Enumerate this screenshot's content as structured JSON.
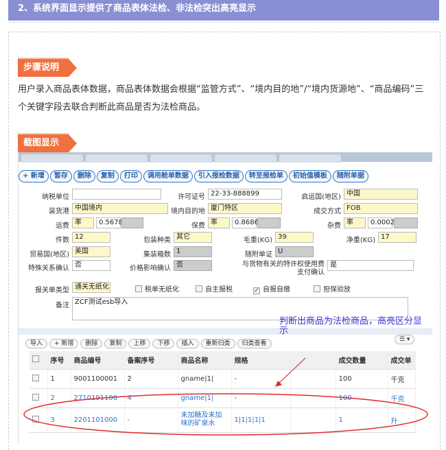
{
  "header": {
    "title": "2、系统界面显示提供了商品表体法检、非法检突出高亮显示"
  },
  "step": {
    "tag": "步骤说明",
    "text": "用户录入商品表体数据，商品表体数据会根据“监管方式”、“境内目的地”/“境内货源地”、“商品编码”三个关键字段去联合判断此商品是否为法检商品。"
  },
  "screenshot": {
    "tag": "截图显示"
  },
  "toolbar": [
    "+ 新增",
    "暂存",
    "删除",
    "复制",
    "打印",
    "调用舱单数据",
    "引入报检数据",
    "转至报检单",
    "初始值模板",
    "随附单据"
  ],
  "form": {
    "consignee_label": "纳税单位",
    "consignee_value": "",
    "license_label": "许可证号",
    "license_value": "22-33-888899",
    "dep_port_label": "启运国(地区)",
    "dep_port_value": "中国",
    "source_label": "装货港",
    "source_value": "中国境内",
    "dest_label": "境内目的地",
    "dest_value": "厦门特区",
    "deal_label": "成交方式",
    "deal_value": "FOB",
    "freight_label": "运费",
    "freight_type": "率",
    "freight_value": "0.5678",
    "insur_label": "保费",
    "insur_type": "率",
    "insur_value": "0.8686",
    "misc_label": "杂费",
    "misc_type": "率",
    "misc_value": "0.0002",
    "pieces_label": "件数",
    "pieces_value": "12",
    "pack_label": "包装种类",
    "pack_value": "其它",
    "gross_label": "毛重(KG)",
    "gross_value": "39",
    "net_label": "净重(KG)",
    "net_value": "17",
    "trade_label": "贸易国(地区)",
    "trade_value": "美国",
    "container_label": "集装箱数",
    "container_value": "1",
    "attach_label": "随附单证",
    "attach_value": "U",
    "special_label": "特殊关系确认",
    "special_value": "否",
    "price_label": "价格影响确认",
    "price_value": "否",
    "royalty_label": "与货物有关的特许权使用费支付确认",
    "royalty_value": "是",
    "decl_type_label": "报关单类型",
    "decl_type_value": "通关无纸化",
    "cb1": "税单无纸化",
    "cb2": "自主报税",
    "cb3": "自报自缴",
    "cb4": "担保验放",
    "remark_label": "备注",
    "remark_value": "ZCF测试esb导入"
  },
  "subtoolbar": [
    "导入",
    "+ 新增",
    "删除",
    "复制",
    "上移",
    "下移",
    "插入",
    "重新归类",
    "归类查看"
  ],
  "table": {
    "headers": [
      "",
      "序号",
      "商品编号",
      "备案序号",
      "商品名称",
      "规格",
      "",
      "成交数量",
      "成交单"
    ],
    "rows": [
      [
        "",
        "1",
        "9001100001",
        "2",
        "gname|1|",
        "-",
        "",
        "100",
        "千克"
      ],
      [
        "",
        "2",
        "2710191100",
        "4",
        "gname|1|",
        "-",
        "",
        "100",
        "千克"
      ],
      [
        "",
        "3",
        "2201101000",
        "-",
        "未加糖及未加味的矿泉水",
        "1|1|1|1|1",
        "",
        "1",
        "升"
      ]
    ]
  },
  "annotation": "判断出商品为法检商品，高亮区分显示"
}
